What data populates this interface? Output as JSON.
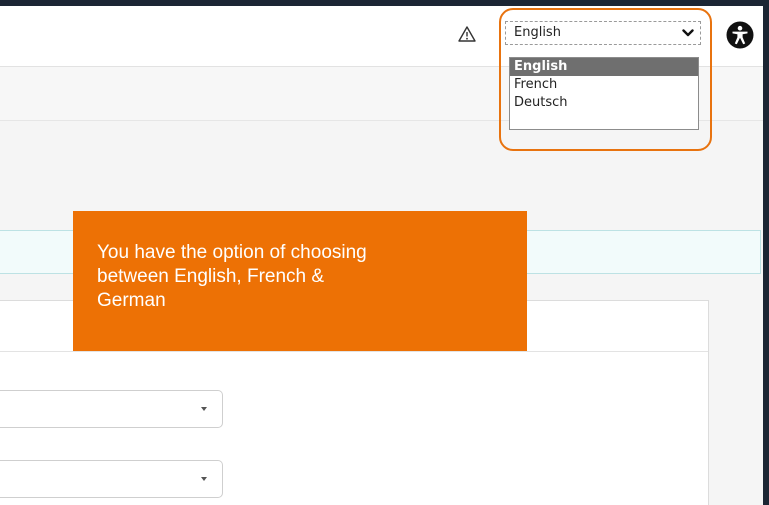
{
  "header": {
    "warning_icon": "warning-triangle-icon",
    "language_select": {
      "value": "English",
      "icon": "chevron-down-icon"
    },
    "accessibility_icon": "accessibility-icon"
  },
  "language_dropdown": {
    "options": [
      "English",
      "French",
      "Deutsch"
    ],
    "selected": "English"
  },
  "callout": {
    "line1": "You have the option of choosing",
    "line2": "between English, French &",
    "line3": "German",
    "color": "#ed7105"
  },
  "colors": {
    "highlight": "#e8730f",
    "background_frame": "#1c2634"
  }
}
